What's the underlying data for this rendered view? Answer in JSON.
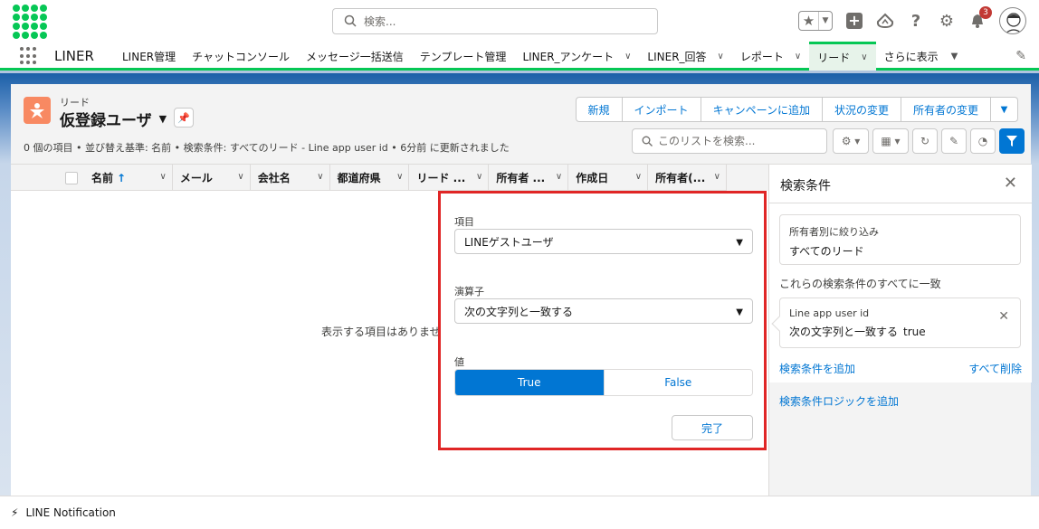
{
  "colors": {
    "brand_green": "#06c755",
    "accent_blue": "#0176d3",
    "highlight_red": "#e02626",
    "lead_icon_orange": "#f88962",
    "notification_red": "#c23934"
  },
  "global_header": {
    "search_placeholder": "検索...",
    "notification_count": "3",
    "icons": [
      "app-logo-icon",
      "search-icon",
      "star-icon",
      "plus-icon",
      "trailhead-icon",
      "help-icon",
      "gear-icon",
      "bell-icon",
      "avatar"
    ]
  },
  "nav": {
    "app_name": "LINER",
    "items": [
      {
        "label": "LINER管理",
        "has_menu": false,
        "active": false
      },
      {
        "label": "チャットコンソール",
        "has_menu": false,
        "active": false
      },
      {
        "label": "メッセージ一括送信",
        "has_menu": false,
        "active": false
      },
      {
        "label": "テンプレート管理",
        "has_menu": false,
        "active": false
      },
      {
        "label": "LINER_アンケート",
        "has_menu": true,
        "active": false
      },
      {
        "label": "LINER_回答",
        "has_menu": true,
        "active": false
      },
      {
        "label": "レポート",
        "has_menu": true,
        "active": false
      },
      {
        "label": "リード",
        "has_menu": true,
        "active": true
      },
      {
        "label": "さらに表示",
        "has_menu": true,
        "active": false
      }
    ]
  },
  "list_view": {
    "object_label": "リード",
    "view_name": "仮登録ユーザ",
    "info": "0 個の項目 • 並び替え基準: 名前 • 検索条件: すべてのリード - Line app user id • 6分前 に更新されました",
    "actions": [
      "新規",
      "インポート",
      "キャンペーンに追加",
      "状況の変更",
      "所有者の変更"
    ],
    "search_placeholder": "このリストを検索...",
    "columns": [
      "名前",
      "メール",
      "会社名",
      "都道府県",
      "リード ...",
      "所有者 ...",
      "作成日",
      "所有者(..."
    ],
    "sort_indicator": "↑",
    "empty_message": "表示する項目はありませ"
  },
  "filter_panel": {
    "title": "検索条件",
    "owner_filter_label": "所有者別に絞り込み",
    "owner_filter_value": "すべてのリード",
    "match_all_label": "これらの検索条件のすべてに一致",
    "condition": {
      "field": "Line app user id",
      "operator": "次の文字列と一致する",
      "value": "true"
    },
    "add_filter_link": "検索条件を追加",
    "remove_all_link": "すべて削除",
    "add_logic_link": "検索条件ロジックを追加"
  },
  "popover": {
    "field_label": "項目",
    "field_value": "LINEゲストユーザ",
    "operator_label": "演算子",
    "operator_value": "次の文字列と一致する",
    "value_label": "値",
    "true_label": "True",
    "false_label": "False",
    "selected": "True",
    "done_label": "完了"
  },
  "utility_bar": {
    "item_label": "LINE Notification"
  }
}
